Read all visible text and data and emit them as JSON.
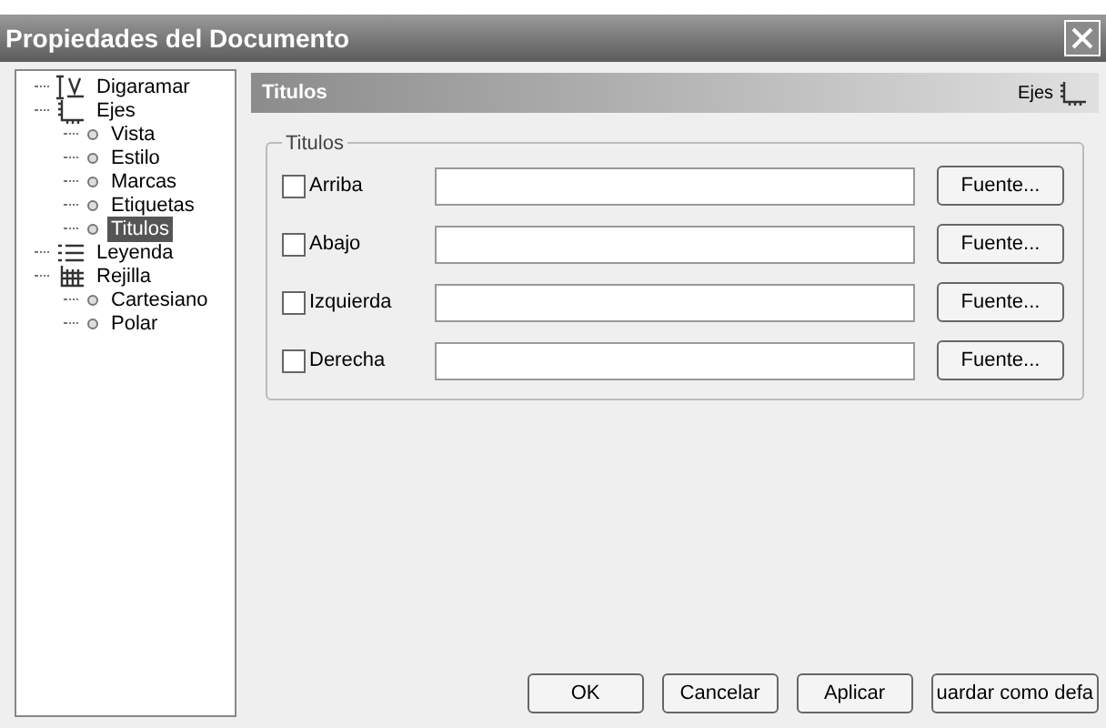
{
  "window": {
    "title": "Propiedades del Documento"
  },
  "tree": [
    {
      "label": "Digaramar",
      "kind": "diagram",
      "selected": false
    },
    {
      "label": "Ejes",
      "kind": "axes",
      "selected": false,
      "children": [
        {
          "label": "Vista",
          "selected": false
        },
        {
          "label": "Estilo",
          "selected": false
        },
        {
          "label": "Marcas",
          "selected": false
        },
        {
          "label": "Etiquetas",
          "selected": false
        },
        {
          "label": "Titulos",
          "selected": true
        }
      ]
    },
    {
      "label": "Leyenda",
      "kind": "legend",
      "selected": false
    },
    {
      "label": "Rejilla",
      "kind": "grid",
      "selected": false,
      "children": [
        {
          "label": "Cartesiano",
          "selected": false
        },
        {
          "label": "Polar",
          "selected": false
        }
      ]
    }
  ],
  "panel": {
    "title": "Titulos",
    "section": "Ejes",
    "group_label": "Titulos",
    "rows": [
      {
        "label": "Arriba",
        "checked": false,
        "button": "Fuente..."
      },
      {
        "label": "Abajo",
        "checked": false,
        "button": "Fuente..."
      },
      {
        "label": "Izquierda",
        "checked": false,
        "button": "Fuente..."
      },
      {
        "label": "Derecha",
        "checked": false,
        "button": "Fuente..."
      }
    ]
  },
  "buttons": [
    "OK",
    "Cancelar",
    "Aplicar",
    "uardar como defa"
  ]
}
